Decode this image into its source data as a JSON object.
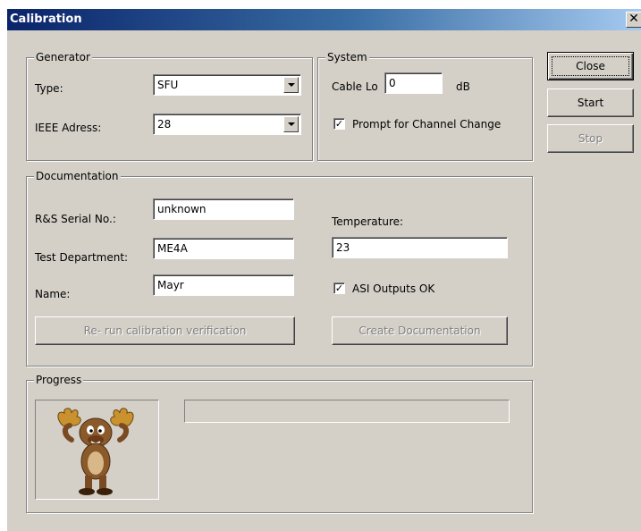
{
  "window": {
    "title": "Calibration",
    "close_glyph": "✕"
  },
  "generator": {
    "legend": "Generator",
    "type_label": "Type:",
    "type_value": "SFU",
    "ieee_label": "IEEE Adress:",
    "ieee_value": "28"
  },
  "system": {
    "legend": "System",
    "cable_label": "Cable Lo",
    "cable_value": "0",
    "cable_unit": "dB",
    "prompt_label": "Prompt for Channel Change",
    "prompt_checked": true
  },
  "buttons": {
    "close": "Close",
    "start": "Start",
    "stop": "Stop"
  },
  "documentation": {
    "legend": "Documentation",
    "serial_label": "R&S Serial No.:",
    "serial_value": "unknown",
    "dept_label": "Test Department:",
    "dept_value": "ME4A",
    "name_label": "Name:",
    "name_value": "Mayr",
    "temperature_label": "Temperature:",
    "temperature_value": "23",
    "asi_label": "ASI Outputs OK",
    "asi_checked": true,
    "rerun_button": "Re- run calibration verification",
    "create_button": "Create Documentation"
  },
  "progress": {
    "legend": "Progress",
    "value_percent": 0,
    "animation_icon": "moose-mascot-icon"
  },
  "colors": {
    "face": "#d4d0c8",
    "title_start": "#0a246a",
    "title_end": "#a6caf0",
    "disabled_text": "#808080"
  }
}
